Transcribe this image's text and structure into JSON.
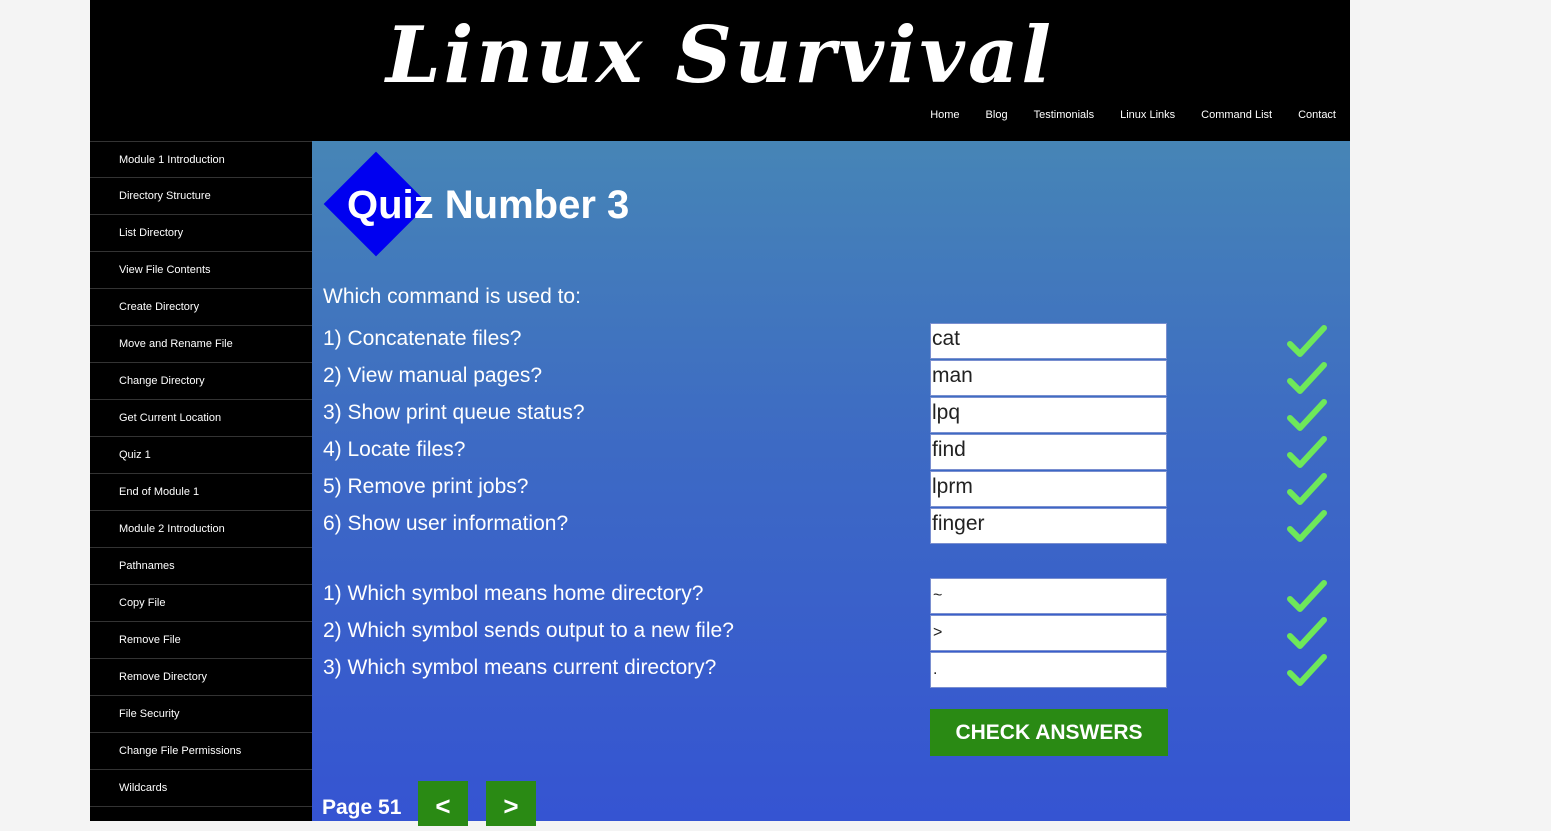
{
  "site": {
    "logo": "Linux Survival",
    "nav": [
      "Home",
      "Blog",
      "Testimonials",
      "Linux Links",
      "Command List",
      "Contact"
    ]
  },
  "sidebar": {
    "items": [
      "Module 1 Introduction",
      "Directory Structure",
      "List Directory",
      "View File Contents",
      "Create Directory",
      "Move and Rename File",
      "Change Directory",
      "Get Current Location",
      "Quiz 1",
      "End of Module 1",
      "Module 2 Introduction",
      "Pathnames",
      "Copy File",
      "Remove File",
      "Remove Directory",
      "File Security",
      "Change File Permissions",
      "Wildcards"
    ]
  },
  "quiz": {
    "title": "Quiz Number 3",
    "intro": "Which command is used to:",
    "commands": [
      {
        "q": "1) Concatenate files?",
        "a": "cat"
      },
      {
        "q": "2) View manual pages?",
        "a": "man"
      },
      {
        "q": "3) Show print queue status?",
        "a": "lpq"
      },
      {
        "q": "4) Locate files?",
        "a": "find"
      },
      {
        "q": "5) Remove print jobs?",
        "a": "lprm"
      },
      {
        "q": "6) Show user information?",
        "a": "finger"
      }
    ],
    "symbols": [
      {
        "q": "1) Which symbol means home directory?",
        "a": "~"
      },
      {
        "q": "2) Which symbol sends output to a new file?",
        "a": ">"
      },
      {
        "q": "3) Which symbol means current directory?",
        "a": "."
      }
    ],
    "check_label": "CHECK ANSWERS",
    "check_color": "#6ee85a"
  },
  "pager": {
    "page_label": "Page 51",
    "prev": "<",
    "next": ">"
  },
  "colors": {
    "button_green": "#2a8a14",
    "diamond_blue": "#0000f0"
  }
}
